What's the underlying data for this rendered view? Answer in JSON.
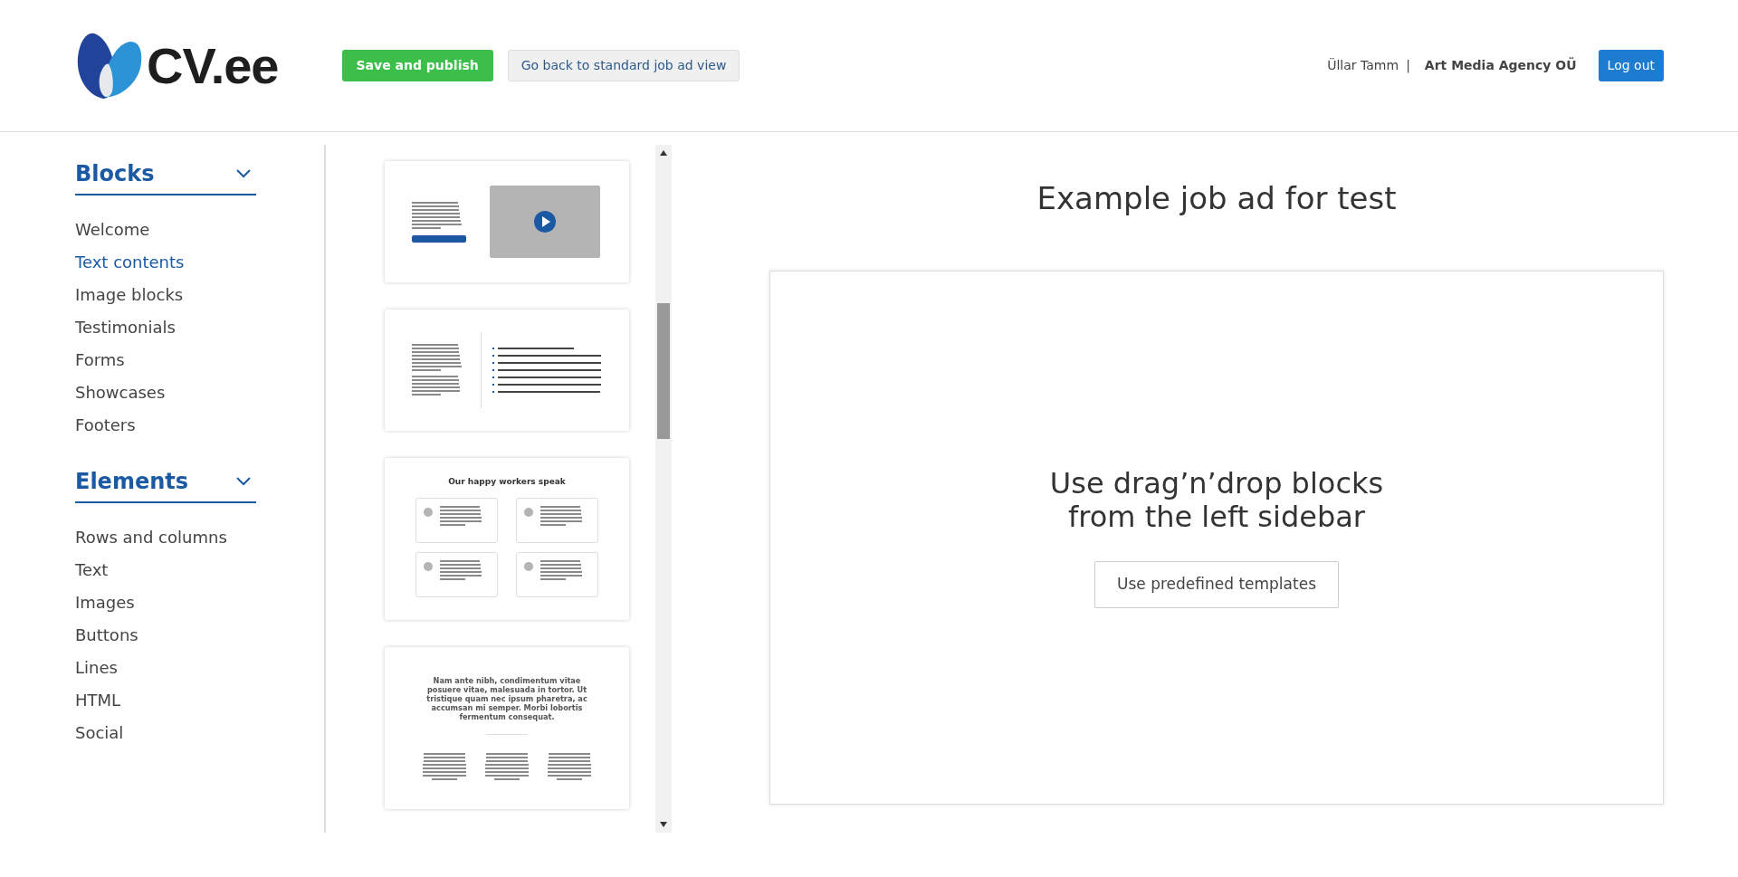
{
  "header": {
    "logo_text": "CV.ee",
    "publish_button": "Save and publish",
    "back_button": "Go back to standard job ad view",
    "user_name": "Üllar Tamm",
    "separator": "|",
    "company": "Art Media Agency OÜ",
    "logout_button": "Log out"
  },
  "sidebar": {
    "sections": [
      {
        "title": "Blocks",
        "expanded": true,
        "items": [
          {
            "label": "Welcome",
            "hovered": false
          },
          {
            "label": "Text contents",
            "hovered": true
          },
          {
            "label": "Image blocks",
            "hovered": false
          },
          {
            "label": "Testimonials",
            "hovered": false
          },
          {
            "label": "Forms",
            "hovered": false
          },
          {
            "label": "Showcases",
            "hovered": false
          },
          {
            "label": "Footers",
            "hovered": false
          }
        ]
      },
      {
        "title": "Elements",
        "expanded": true,
        "items": [
          {
            "label": "Rows and columns",
            "hovered": false
          },
          {
            "label": "Text",
            "hovered": false
          },
          {
            "label": "Images",
            "hovered": false
          },
          {
            "label": "Buttons",
            "hovered": false
          },
          {
            "label": "Lines",
            "hovered": false
          },
          {
            "label": "HTML",
            "hovered": false
          },
          {
            "label": "Social",
            "hovered": false
          }
        ]
      }
    ]
  },
  "block_previews": [
    {
      "kind": "video"
    },
    {
      "kind": "list"
    },
    {
      "kind": "testimonials",
      "title": "Our happy workers speak"
    },
    {
      "kind": "columns",
      "title": "Nam ante nibh, condimentum vitae posuere vitae, malesuada in tortor. Ut tristique quam nec ipsum pharetra, ac accumsan mi semper. Morbi lobortis fermentum consequat."
    }
  ],
  "main": {
    "title": "Example job ad for test",
    "canvas_message": "Use drag’n’drop blocks\nfrom the left sidebar",
    "templates_button": "Use predefined templates"
  }
}
